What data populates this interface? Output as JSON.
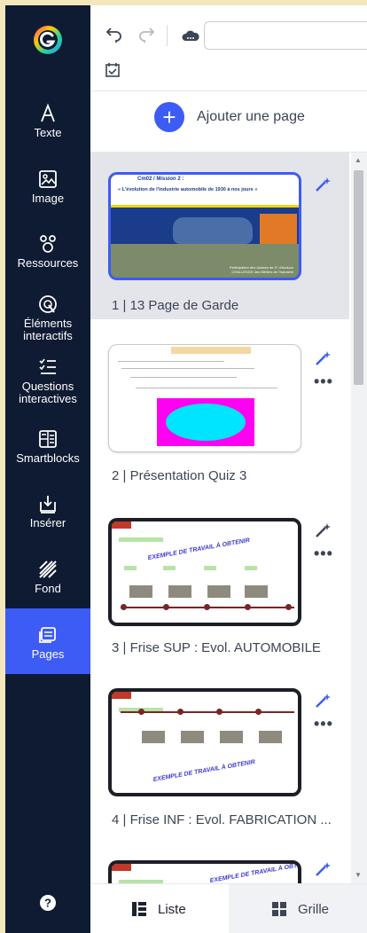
{
  "rail": {
    "items": [
      {
        "label": "Texte",
        "icon": "text-icon"
      },
      {
        "label": "Image",
        "icon": "image-icon"
      },
      {
        "label": "Ressources",
        "icon": "resources-icon"
      },
      {
        "label": "Éléments interactifs",
        "icon": "interactive-elements-icon"
      },
      {
        "label": "Questions interactives",
        "icon": "interactive-questions-icon"
      },
      {
        "label": "Smartblocks",
        "icon": "smartblocks-icon"
      },
      {
        "label": "Insérer",
        "icon": "insert-icon"
      },
      {
        "label": "Fond",
        "icon": "background-icon"
      },
      {
        "label": "Pages",
        "icon": "pages-icon"
      }
    ],
    "active": "Pages"
  },
  "add_page": {
    "label": "Ajouter une page"
  },
  "pages": [
    {
      "label": "1 |  13  Page de Garde",
      "selected": true,
      "thumb": {
        "title": "Cm02 / Mission 2 :",
        "subtitle": "« L'évolution de l'industrie automobile de 1930 à nos jours »",
        "footer": "Participation des classes de 3° d'Anduze CHALLENGE des Métiers de l'Industrie"
      }
    },
    {
      "label": "2 |  Présentation Quiz 3",
      "selected": false
    },
    {
      "label": "3 |  Frise SUP : Evol. AUTOMOBILE",
      "selected": false,
      "thumb": {
        "stamp": "EXEMPLE DE TRAVAIL À OBTENIR"
      }
    },
    {
      "label": "4 |  Frise INF : Evol. FABRICATION ...",
      "selected": false,
      "thumb": {
        "stamp": "EXEMPLE DE TRAVAIL À OBTENIR"
      }
    },
    {
      "label": "",
      "selected": false,
      "thumb": {
        "stamp": "EXEMPLE DE TRAVAIL À OBTENIR"
      }
    }
  ],
  "tabs": [
    {
      "label": "Liste",
      "icon": "list-view-icon",
      "active": true
    },
    {
      "label": "Grille",
      "icon": "grid-view-icon",
      "active": false
    }
  ],
  "colors": {
    "rail": "#0f1b33",
    "accent": "#3d5bf5",
    "selected_row": "#e3e5eb"
  }
}
